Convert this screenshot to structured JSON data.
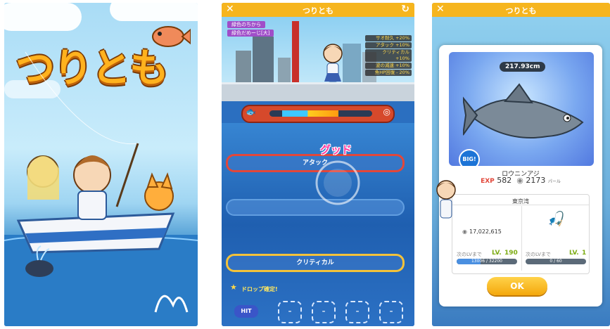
{
  "title_screen": {
    "logo_text": "つりとも"
  },
  "battle_screen": {
    "header": {
      "title": "つりとも",
      "close_icon": "close-icon",
      "refresh_icon": "refresh-icon"
    },
    "buff_tags": [
      "緑色のちから",
      "緑色だめーじ[大]"
    ],
    "stats": [
      "サオ耐久 +20%",
      "アタック +10%",
      "クリティカル +10%",
      "波の減速 +10%",
      "魚HP回復 - 20%"
    ],
    "gauge_level": 0.55,
    "slots": [
      {
        "label": "アタック",
        "style": "red"
      },
      {
        "label": "",
        "style": "plain"
      },
      {
        "label": "クリティカル",
        "style": "gold"
      }
    ],
    "reaction_text": "グッド",
    "drop_text": "ドロップ確定!",
    "hit_label": "HIT",
    "hit_slots": [
      "-",
      "-",
      "-",
      "-"
    ]
  },
  "result_screen": {
    "header": {
      "title": "つりとも"
    },
    "fish_size": "217.93cm",
    "big_badge": "BIG!",
    "fish_name": "ロウニンアジ",
    "exp_label": "EXP",
    "exp_value": "582",
    "pearl_value": "2173",
    "pearl_unit": "パール",
    "location": "東京湾",
    "coins": "17,022,615",
    "player": {
      "next_label": "次のLVまで",
      "lv_label": "LV.",
      "lv": "190",
      "progress_text": "13006 / 32200",
      "progress": 0.4
    },
    "rod": {
      "next_label": "次のLVまで",
      "lv_label": "LV.",
      "lv": "1",
      "progress_text": "0 / 60",
      "progress": 0.0
    },
    "ok_label": "OK"
  },
  "colors": {
    "header": "#f6b51e",
    "accent_pink": "#ff3aa0",
    "lv_green": "#7cab12",
    "exp_red": "#e2473a"
  }
}
